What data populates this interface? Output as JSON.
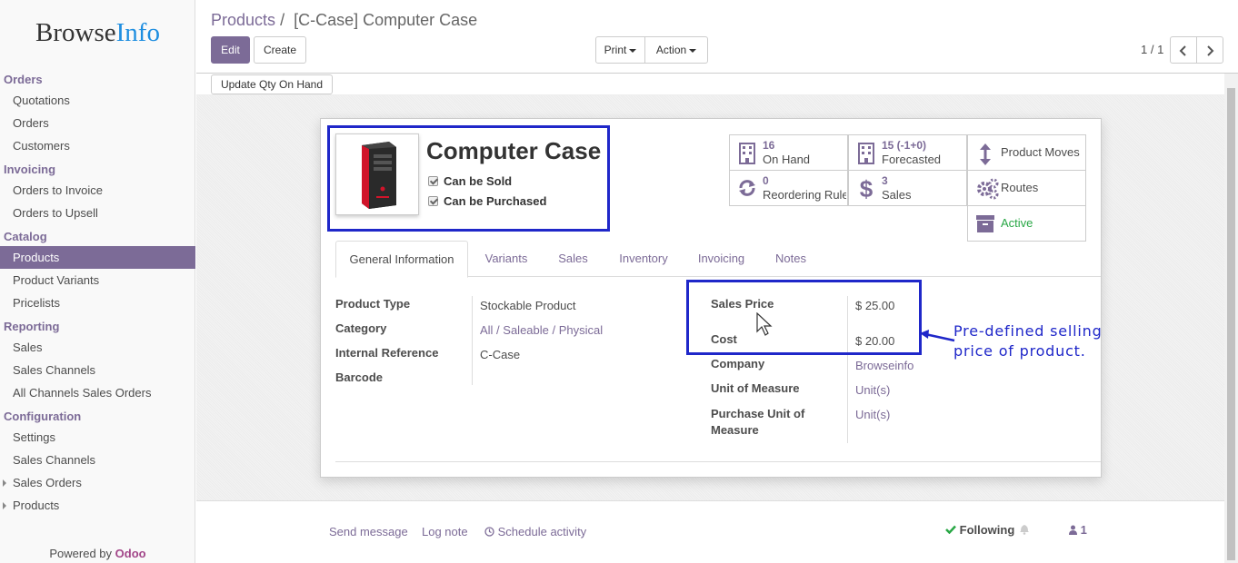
{
  "sidebar": {
    "logo_main": "Browse",
    "logo_accent": "Info",
    "sections": [
      {
        "title": "Orders",
        "items": [
          {
            "label": "Quotations"
          },
          {
            "label": "Orders"
          },
          {
            "label": "Customers"
          }
        ]
      },
      {
        "title": "Invoicing",
        "items": [
          {
            "label": "Orders to Invoice"
          },
          {
            "label": "Orders to Upsell"
          }
        ]
      },
      {
        "title": "Catalog",
        "items": [
          {
            "label": "Products"
          },
          {
            "label": "Product Variants"
          },
          {
            "label": "Pricelists"
          }
        ]
      },
      {
        "title": "Reporting",
        "items": [
          {
            "label": "Sales"
          },
          {
            "label": "Sales Channels"
          },
          {
            "label": "All Channels Sales Orders"
          }
        ]
      },
      {
        "title": "Configuration",
        "items": [
          {
            "label": "Settings"
          },
          {
            "label": "Sales Channels"
          },
          {
            "label": "Sales Orders"
          },
          {
            "label": "Products"
          }
        ]
      }
    ],
    "powered_prefix": "Powered by ",
    "powered_brand": "Odoo"
  },
  "control": {
    "breadcrumb_parent": "Products",
    "breadcrumb_sep": "/",
    "breadcrumb_current": "[C-Case] Computer Case",
    "edit_label": "Edit",
    "create_label": "Create",
    "print_label": "Print",
    "action_label": "Action",
    "pager": "1 / 1"
  },
  "statusbar": {
    "update_qty_label": "Update Qty On Hand"
  },
  "product": {
    "name": "Computer Case",
    "can_be_sold": "Can be Sold",
    "can_be_purchased": "Can be Purchased"
  },
  "smart_buttons": {
    "on_hand": {
      "value": "16",
      "label": "On Hand"
    },
    "forecasted": {
      "value": "15 (-1+0)",
      "label": "Forecasted"
    },
    "product_moves": {
      "label": "Product Moves"
    },
    "reordering": {
      "value": "0",
      "label": "Reordering Rules"
    },
    "sales": {
      "value": "3",
      "label": "Sales"
    },
    "routes": {
      "label": "Routes"
    },
    "active": {
      "label": "Active"
    }
  },
  "tabs": [
    "General Information",
    "Variants",
    "Sales",
    "Inventory",
    "Invoicing",
    "Notes"
  ],
  "fields_left": [
    {
      "label": "Product Type",
      "value": "Stockable Product"
    },
    {
      "label": "Category",
      "value": "All / Saleable / Physical"
    },
    {
      "label": "Internal Reference",
      "value": "C-Case"
    },
    {
      "label": "Barcode",
      "value": ""
    }
  ],
  "fields_right": [
    {
      "label": "Sales Price",
      "value": "$ 25.00"
    },
    {
      "label": "Cost",
      "value": "$ 20.00"
    },
    {
      "label": "Company",
      "value": "Browseinfo"
    },
    {
      "label": "Unit of Measure",
      "value": "Unit(s)"
    },
    {
      "label": "Purchase Unit of Measure",
      "value": "Unit(s)"
    }
  ],
  "annotation": {
    "line1": "Pre-defined selling",
    "line2": "price of product."
  },
  "chatter": {
    "send_message": "Send message",
    "log_note": "Log note",
    "schedule_activity": "Schedule activity",
    "following": "Following",
    "followers_count": "1"
  },
  "colors": {
    "accent": "#7c6b97",
    "highlight": "#1f27c9",
    "active_green": "#28a745"
  }
}
